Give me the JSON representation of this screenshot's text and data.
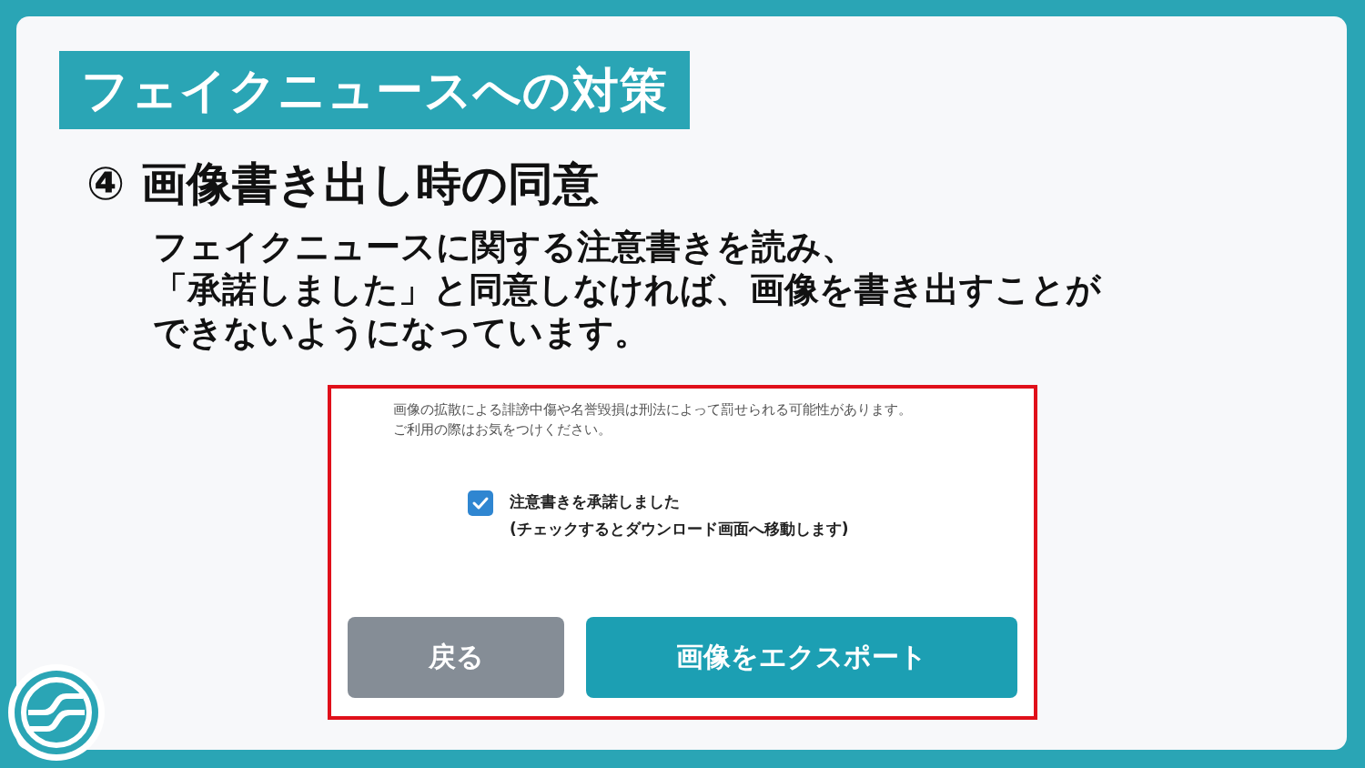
{
  "title": "フェイクニュースへの対策",
  "heading": "④ 画像書き出し時の同意",
  "body": [
    "フェイクニュースに関する注意書きを読み、",
    "「承諾しました」と同意しなければ、画像を書き出すことが",
    "できないようになっています。"
  ],
  "dialog": {
    "notice": [
      "画像の拡散による誹謗中傷や名誉毀損は刑法によって罰せられる可能性があります。",
      "ご利用の際はお気をつけください。"
    ],
    "consent": {
      "checked": true,
      "label": "注意書きを承諾しました",
      "hint": "(チェックするとダウンロード画面へ移動します)"
    },
    "buttons": [
      {
        "kind": "secondary",
        "label": "戻る"
      },
      {
        "kind": "primary",
        "label": "画像をエクスポート"
      }
    ]
  }
}
